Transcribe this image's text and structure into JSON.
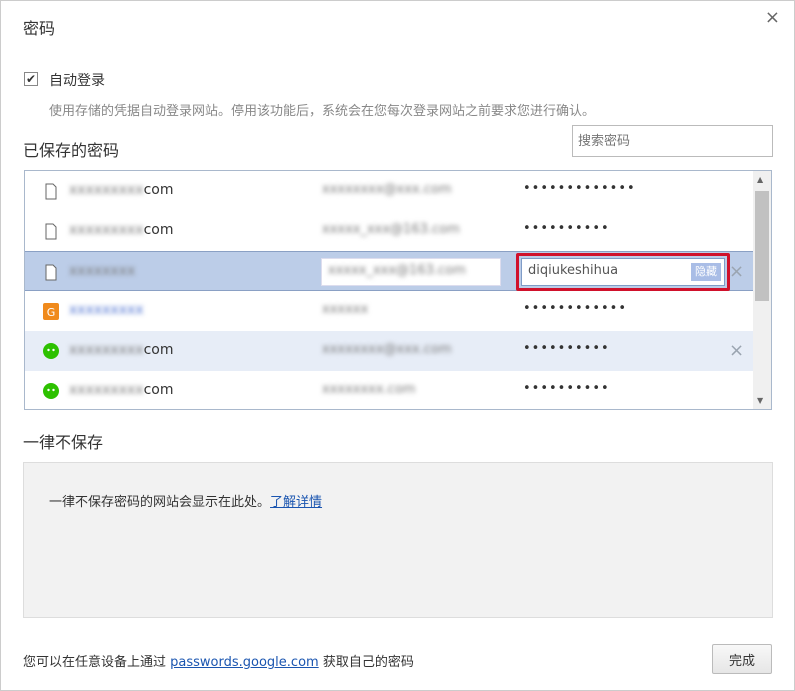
{
  "dialog": {
    "title": "密码",
    "close": "×"
  },
  "autologin": {
    "checked": true,
    "checkmark": "✔",
    "label": "自动登录",
    "description": "使用存储的凭据自动登录网站。停用该功能后，系统会在您每次登录网站之前要求您进行确认。"
  },
  "saved": {
    "heading": "已保存的密码",
    "search_placeholder": "搜索密码",
    "rows": [
      {
        "icon": "page-icon",
        "site_suffix": "com",
        "site_blur": "xxxxxxxxx",
        "user": "xxxxxxxx@xxx.com",
        "password": "•••••••••••••"
      },
      {
        "icon": "page-icon",
        "site_suffix": "com",
        "site_blur": "xxxxxxxxx",
        "user": "xxxxx_xxx@163.com",
        "password": "••••••••••"
      },
      {
        "icon": "page-icon",
        "site_suffix": "",
        "site_blur": "xxxxxxxx",
        "user": "xxxxx_xxx@163.com",
        "password_shown": "diqiukeshihua",
        "hide_label": "隐藏",
        "delete": "×"
      },
      {
        "icon": "g-icon",
        "site_suffix": "",
        "site_blur": "xxxxxxxxx",
        "user": "xxxxxx",
        "password": "••••••••••••"
      },
      {
        "icon": "wechat-icon",
        "site_suffix": "com",
        "site_blur": "xxxxxxxxx",
        "user": "xxxxxxxx@xxx.com",
        "password": "••••••••••",
        "delete": "×"
      },
      {
        "icon": "wechat-icon",
        "site_suffix": "com",
        "site_blur": "xxxxxxxxx",
        "user": "xxxxxxxx.com",
        "password": "••••••••••"
      }
    ]
  },
  "never": {
    "heading": "一律不保存",
    "text": "一律不保存密码的网站会显示在此处。",
    "link": "了解详情"
  },
  "footer": {
    "prefix": "您可以在任意设备上通过 ",
    "link": "passwords.google.com",
    "suffix": " 获取自己的密码",
    "done": "完成"
  }
}
